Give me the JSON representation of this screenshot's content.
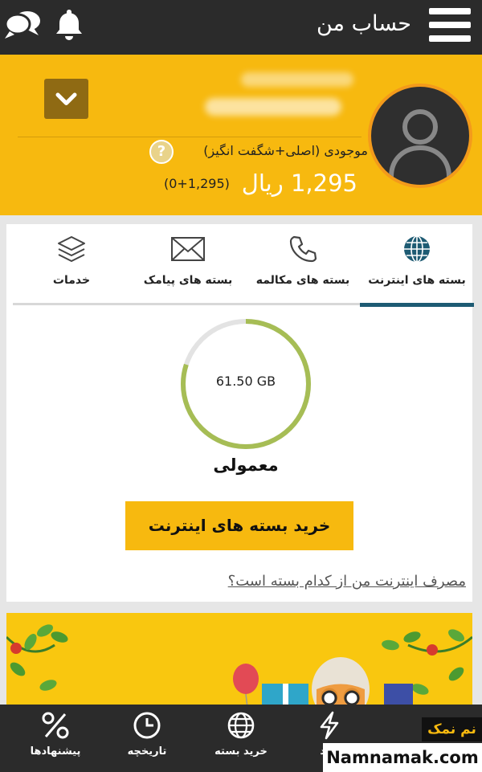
{
  "header": {
    "title": "حساب من",
    "menu_icon": "hamburger-icon",
    "notification_icon": "bell-icon",
    "chat_icon": "chat-icon"
  },
  "account": {
    "balance_label": "موجودی (اصلی+شگفت انگیز)",
    "balance_value": "1,295 ریال",
    "balance_detail": "(0+1,295)",
    "help_symbol": "?",
    "colors": {
      "header_bg": "#f7b90f",
      "avatar_ring": "#f39a1b"
    }
  },
  "tabs": [
    {
      "label": "بسته های اینترنت",
      "icon": "globe-icon",
      "active": true
    },
    {
      "label": "بسته های مکالمه",
      "icon": "phone-icon",
      "active": false
    },
    {
      "label": "بسته های پیامک",
      "icon": "envelope-icon",
      "active": false
    },
    {
      "label": "خدمات",
      "icon": "layers-icon",
      "active": false
    }
  ],
  "package": {
    "remaining": "61.50 GB",
    "remaining_fraction": 0.8,
    "plan_name": "معمولی",
    "buy_button": "خرید بسته های اینترنت",
    "usage_link": "مصرف اینترنت من از کدام بسته است؟"
  },
  "bottom_nav": [
    {
      "label": "پیشنهادها",
      "icon": "percent-icon"
    },
    {
      "label": "تاریخچه",
      "icon": "clock-icon"
    },
    {
      "label": "خرید بسته",
      "icon": "globe-icon"
    },
    {
      "label": "جدد",
      "icon": "lightning-icon"
    }
  ],
  "watermark": {
    "brand": "نم نمک",
    "site": "Namnamak.com"
  },
  "colors": {
    "dark_bar": "#2b2b2b",
    "accent": "#f7b90f",
    "tab_active": "#1e5b73",
    "gauge_green": "#a6bd55"
  }
}
